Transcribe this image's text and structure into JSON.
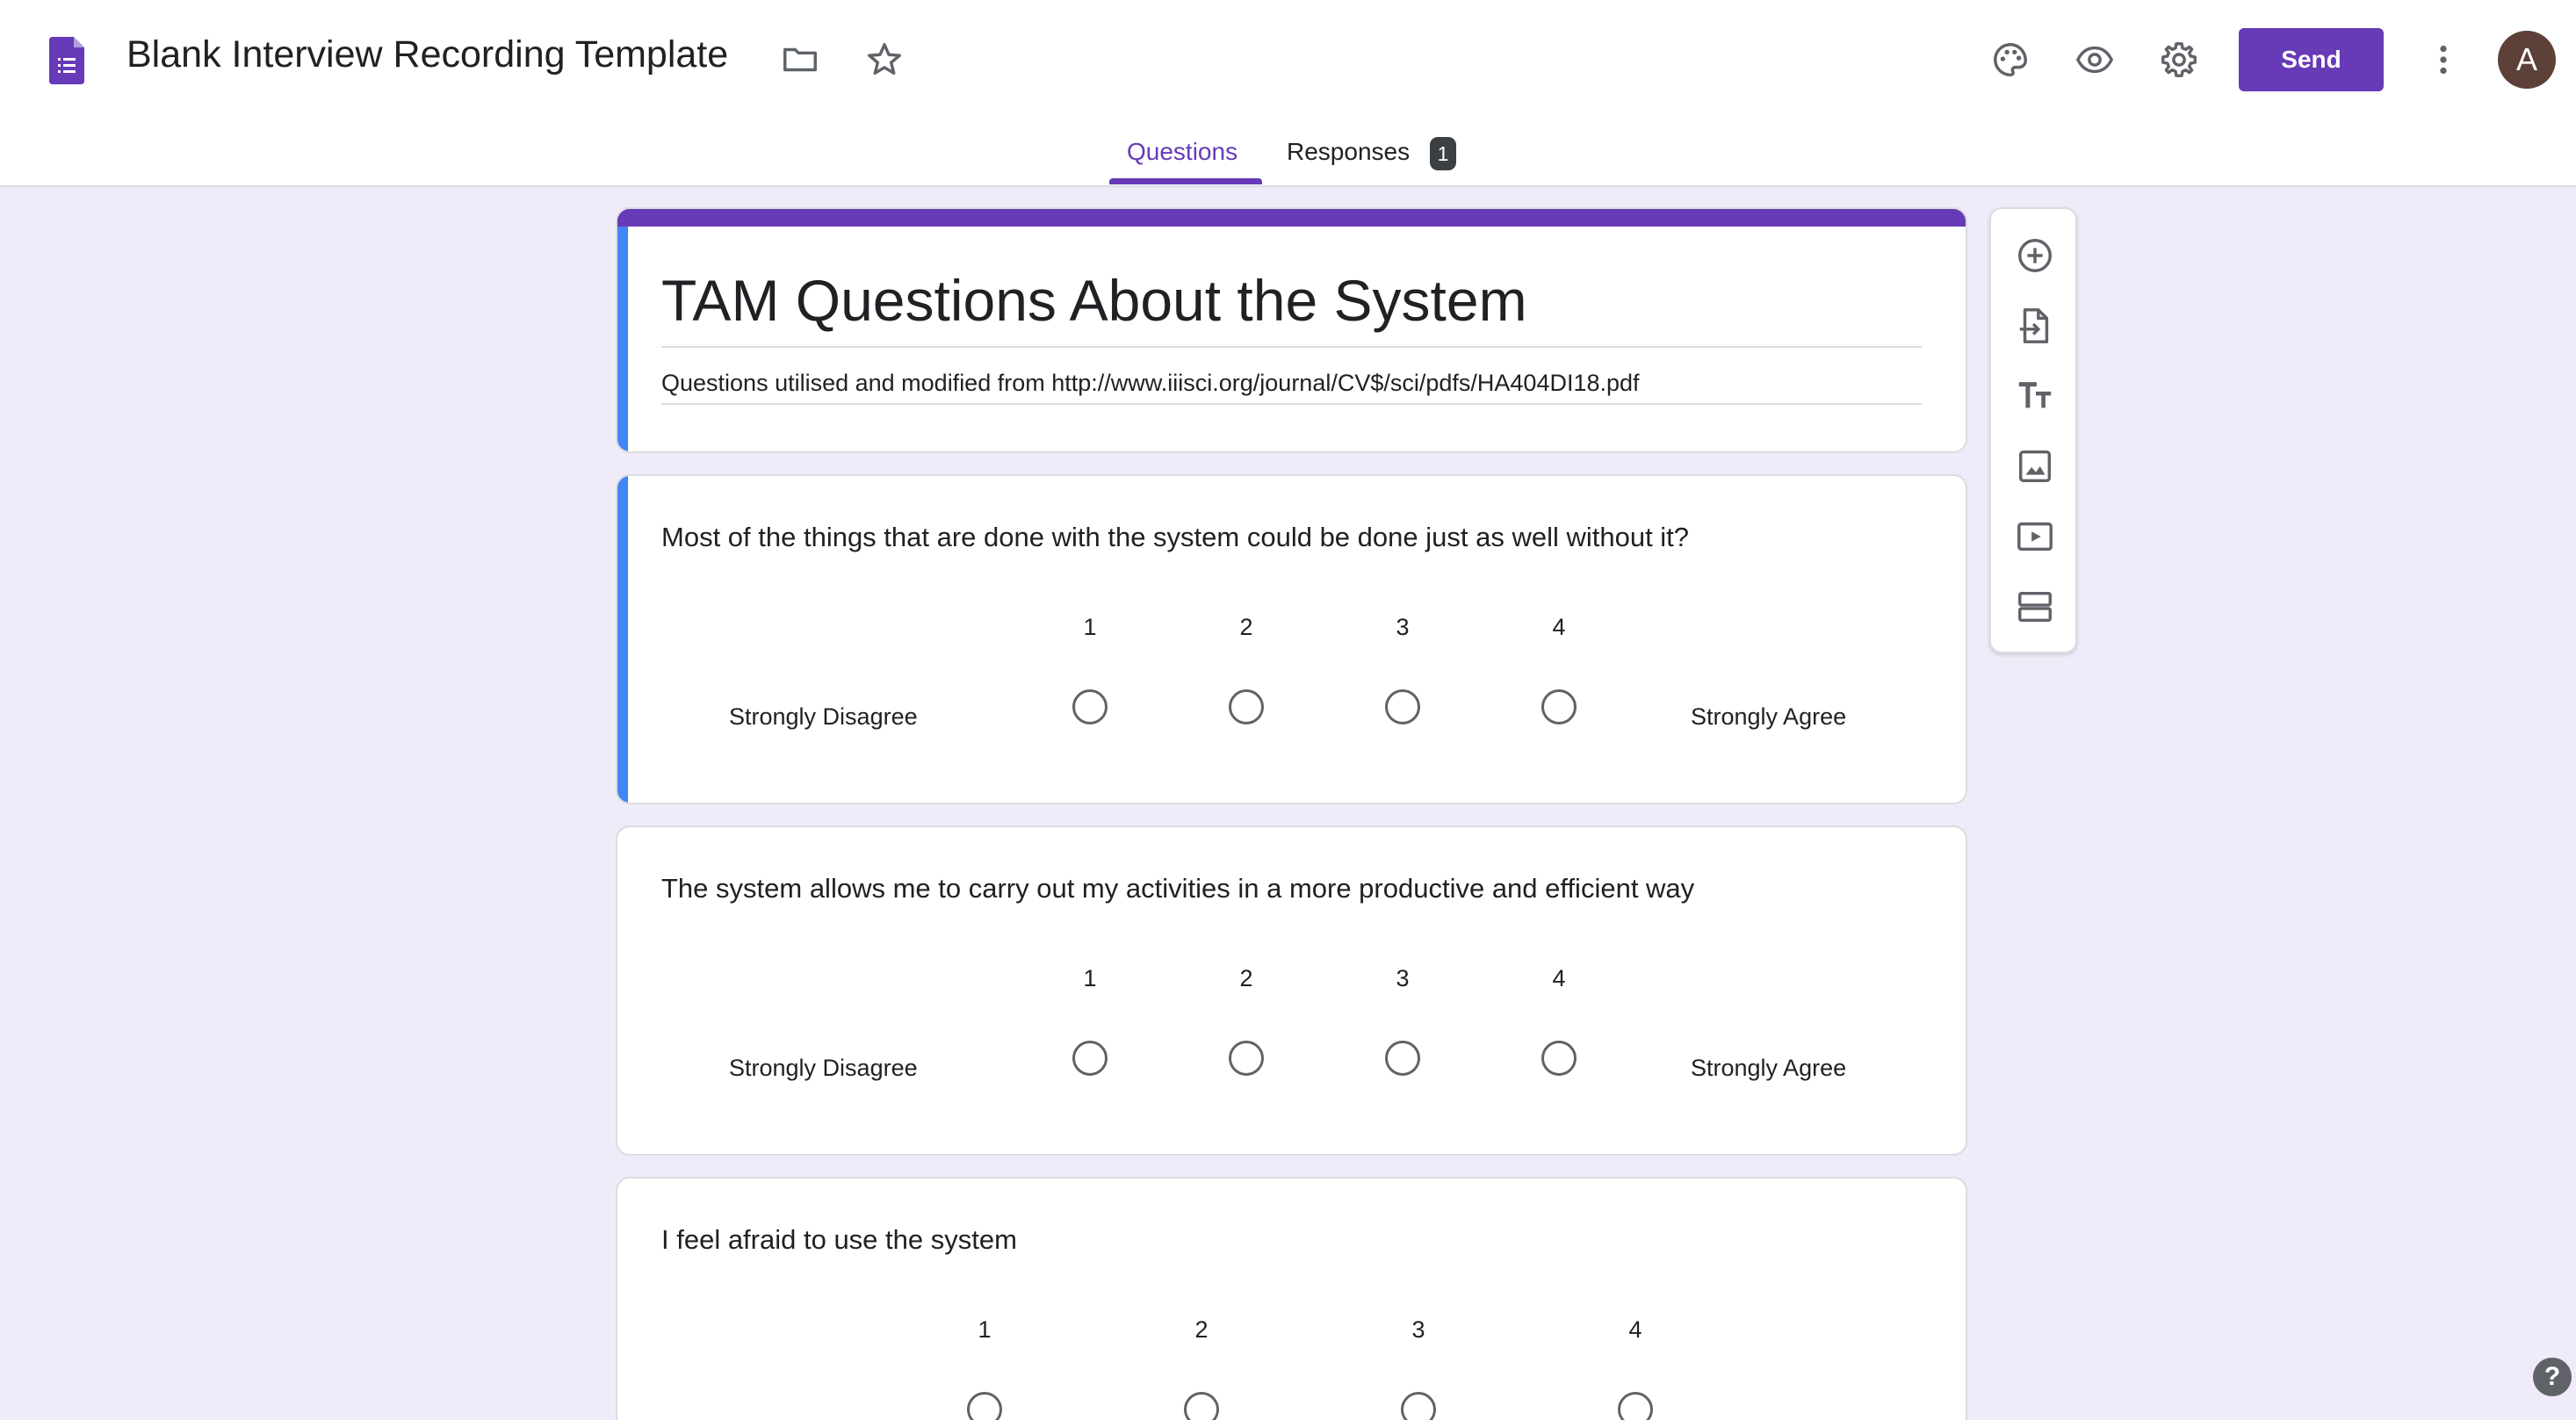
{
  "header": {
    "doc_title": "Blank Interview Recording Template",
    "send_label": "Send",
    "avatar_initial": "A",
    "accent_color": "#673ab7",
    "icons": [
      "forms-app-icon",
      "folder-icon",
      "star-icon",
      "palette-icon",
      "preview-eye-icon",
      "settings-gear-icon",
      "more-vert-icon"
    ]
  },
  "tabs": {
    "questions": "Questions",
    "responses": "Responses",
    "responses_count": "1",
    "active": "Questions"
  },
  "form": {
    "title": "TAM Questions About the System",
    "description": "Questions utilised and modified from http://www.iiisci.org/journal/CV$/sci/pdfs/HA404DI18.pdf"
  },
  "questions": [
    {
      "text": "Most of the things that are done with the system could be done just as well without it?",
      "scale": [
        "1",
        "2",
        "3",
        "4"
      ],
      "low_label": "Strongly Disagree",
      "high_label": "Strongly Agree",
      "active": true
    },
    {
      "text": "The system allows me to carry out my activities in a more productive and efficient way",
      "scale": [
        "1",
        "2",
        "3",
        "4"
      ],
      "low_label": "Strongly Disagree",
      "high_label": "Strongly Agree",
      "active": false
    },
    {
      "text": "I feel afraid to use the system",
      "scale": [
        "1",
        "2",
        "3",
        "4"
      ],
      "active": false
    }
  ],
  "toolbar": {
    "icons": [
      "add-question-icon",
      "import-questions-icon",
      "add-title-icon",
      "add-image-icon",
      "add-video-icon",
      "add-section-icon"
    ]
  },
  "help_label": "?"
}
